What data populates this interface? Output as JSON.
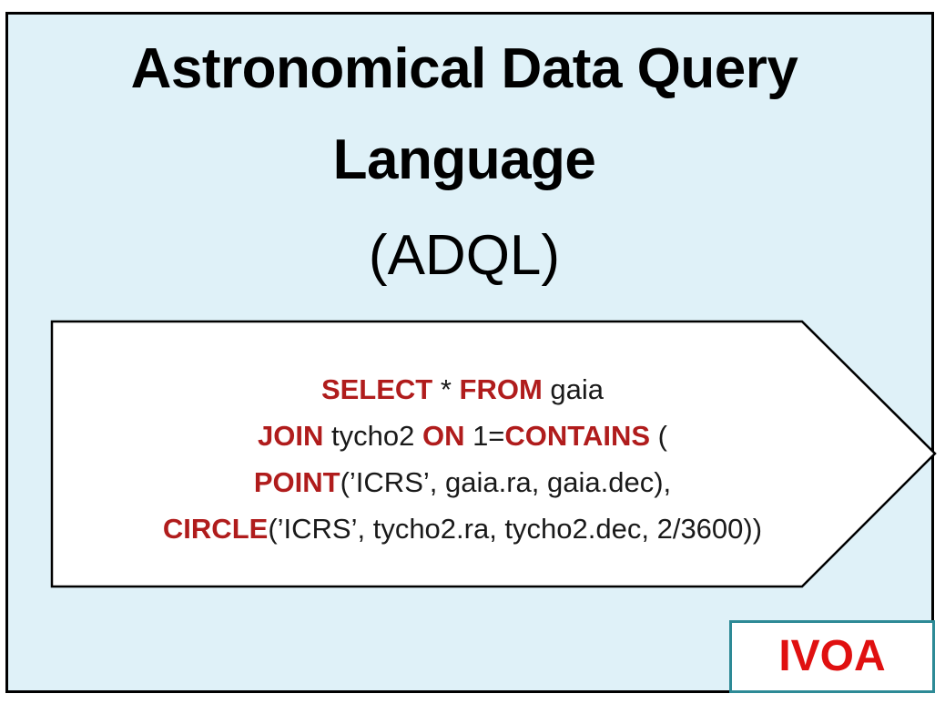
{
  "title": {
    "line1": "Astronomical Data Query",
    "line2": "Language",
    "line3": "(ADQL)"
  },
  "query": {
    "line1": [
      {
        "t": "SELECT",
        "kw": true
      },
      {
        "t": " * ",
        "kw": false
      },
      {
        "t": "FROM",
        "kw": true
      },
      {
        "t": " gaia",
        "kw": false
      }
    ],
    "line2": [
      {
        "t": "JOIN",
        "kw": true
      },
      {
        "t": " tycho2 ",
        "kw": false
      },
      {
        "t": "ON",
        "kw": true
      },
      {
        "t": " 1=",
        "kw": false
      },
      {
        "t": "CONTAINS",
        "kw": true
      },
      {
        "t": " (",
        "kw": false
      }
    ],
    "line3": [
      {
        "t": "POINT",
        "kw": true
      },
      {
        "t": "(’ICRS’, gaia.ra, gaia.dec),",
        "kw": false
      }
    ],
    "line4": [
      {
        "t": "CIRCLE",
        "kw": true
      },
      {
        "t": "(’ICRS’, tycho2.ra, tycho2.dec, 2/3600))",
        "kw": false
      }
    ]
  },
  "badge": {
    "label": "IVOA"
  },
  "colors": {
    "background": "#dff1f8",
    "keyword": "#b01c1c",
    "badge_text": "#e01010",
    "badge_border": "#2d8a96"
  }
}
